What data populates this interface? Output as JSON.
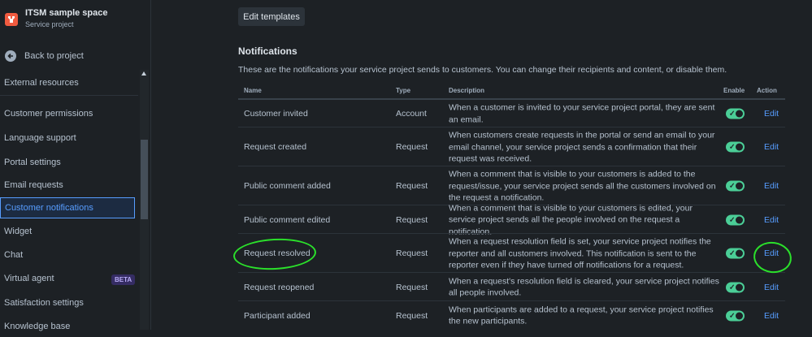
{
  "sidebar": {
    "project_name": "ITSM sample space",
    "project_type": "Service project",
    "back_label": "Back to project",
    "items": [
      {
        "label": "External resources"
      },
      {
        "label": "Customer permissions"
      },
      {
        "label": "Language support"
      },
      {
        "label": "Portal settings"
      },
      {
        "label": "Email requests"
      },
      {
        "label": "Customer notifications",
        "active": true
      },
      {
        "label": "Widget"
      },
      {
        "label": "Chat"
      },
      {
        "label": "Virtual agent",
        "badge": "BETA"
      },
      {
        "label": "Satisfaction settings"
      },
      {
        "label": "Knowledge base"
      }
    ]
  },
  "main": {
    "edit_templates_label": "Edit templates",
    "section_title": "Notifications",
    "section_description": "These are the notifications your service project sends to customers. You can change their recipients and content, or disable them.",
    "columns": {
      "name": "Name",
      "type": "Type",
      "description": "Description",
      "enable": "Enable",
      "action": "Action"
    },
    "rows": [
      {
        "name": "Customer invited",
        "type": "Account",
        "description": "When a customer is invited to your service project portal, they are sent an email.",
        "enabled": true,
        "action": "Edit"
      },
      {
        "name": "Request created",
        "type": "Request",
        "description": "When customers create requests in the portal or send an email to your email channel, your service project sends a confirmation that their request was received.",
        "enabled": true,
        "action": "Edit"
      },
      {
        "name": "Public comment added",
        "type": "Request",
        "description": "When a comment that is visible to your customers is added to the request/issue, your service project sends all the customers involved on the request a notification.",
        "enabled": true,
        "action": "Edit"
      },
      {
        "name": "Public comment edited",
        "type": "Request",
        "description": "When a comment that is visible to your customers is edited, your service project sends all the people involved on the request a notification.",
        "enabled": true,
        "action": "Edit"
      },
      {
        "name": "Request resolved",
        "type": "Request",
        "description": "When a request resolution field is set, your service project notifies the reporter and all customers involved. This notification is sent to the reporter even if they have turned off notifications for a request.",
        "enabled": true,
        "action": "Edit"
      },
      {
        "name": "Request reopened",
        "type": "Request",
        "description": "When a request's resolution field is cleared, your service project notifies all people involved.",
        "enabled": true,
        "action": "Edit"
      },
      {
        "name": "Participant added",
        "type": "Request",
        "description": "When participants are added to a request, your service project notifies the new participants.",
        "enabled": true,
        "action": "Edit"
      }
    ]
  },
  "colors": {
    "background": "#1d2125",
    "accent_link": "#579dff",
    "toggle_on": "#4bce97",
    "annotation": "#2be02b",
    "project_icon": "#f15b40"
  },
  "icons": [
    "project-logo-icon",
    "back-arrow-icon",
    "check-icon",
    "scroll-up-icon"
  ]
}
